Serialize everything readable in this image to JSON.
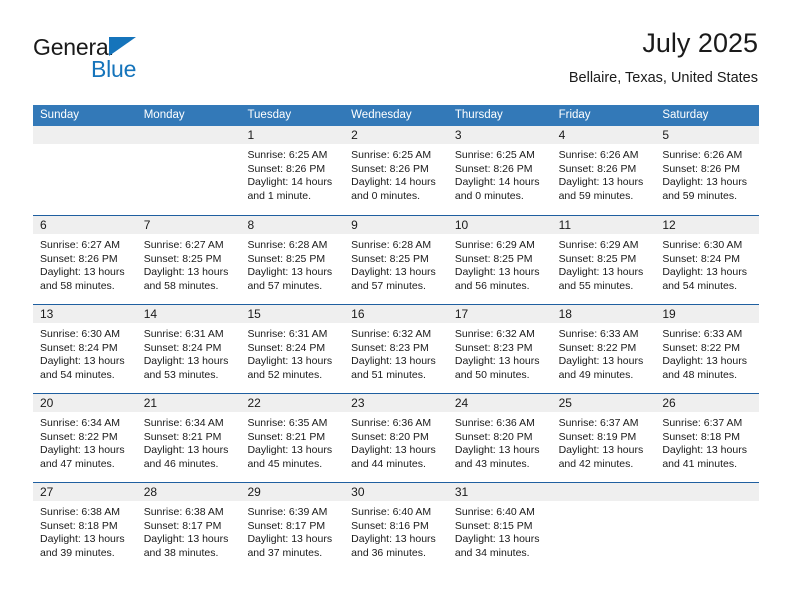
{
  "brand": {
    "name_top": "General",
    "name_bottom": "Blue",
    "logo_icon": "blue-triangle-icon",
    "colors": {
      "black": "#1a1a1a",
      "blue": "#1574bb"
    }
  },
  "header": {
    "title": "July 2025",
    "subtitle": "Bellaire, Texas, United States"
  },
  "theme": {
    "header_blue": "#3379b8",
    "row_divider_blue": "#1f5fa0",
    "day_band_gray": "#efefef"
  },
  "calendar": {
    "weekdays": [
      "Sunday",
      "Monday",
      "Tuesday",
      "Wednesday",
      "Thursday",
      "Friday",
      "Saturday"
    ],
    "weeks": [
      [
        {
          "day": "",
          "lines": []
        },
        {
          "day": "",
          "lines": []
        },
        {
          "day": "1",
          "lines": [
            "Sunrise: 6:25 AM",
            "Sunset: 8:26 PM",
            "Daylight: 14 hours",
            "and 1 minute."
          ]
        },
        {
          "day": "2",
          "lines": [
            "Sunrise: 6:25 AM",
            "Sunset: 8:26 PM",
            "Daylight: 14 hours",
            "and 0 minutes."
          ]
        },
        {
          "day": "3",
          "lines": [
            "Sunrise: 6:25 AM",
            "Sunset: 8:26 PM",
            "Daylight: 14 hours",
            "and 0 minutes."
          ]
        },
        {
          "day": "4",
          "lines": [
            "Sunrise: 6:26 AM",
            "Sunset: 8:26 PM",
            "Daylight: 13 hours",
            "and 59 minutes."
          ]
        },
        {
          "day": "5",
          "lines": [
            "Sunrise: 6:26 AM",
            "Sunset: 8:26 PM",
            "Daylight: 13 hours",
            "and 59 minutes."
          ]
        }
      ],
      [
        {
          "day": "6",
          "lines": [
            "Sunrise: 6:27 AM",
            "Sunset: 8:26 PM",
            "Daylight: 13 hours",
            "and 58 minutes."
          ]
        },
        {
          "day": "7",
          "lines": [
            "Sunrise: 6:27 AM",
            "Sunset: 8:25 PM",
            "Daylight: 13 hours",
            "and 58 minutes."
          ]
        },
        {
          "day": "8",
          "lines": [
            "Sunrise: 6:28 AM",
            "Sunset: 8:25 PM",
            "Daylight: 13 hours",
            "and 57 minutes."
          ]
        },
        {
          "day": "9",
          "lines": [
            "Sunrise: 6:28 AM",
            "Sunset: 8:25 PM",
            "Daylight: 13 hours",
            "and 57 minutes."
          ]
        },
        {
          "day": "10",
          "lines": [
            "Sunrise: 6:29 AM",
            "Sunset: 8:25 PM",
            "Daylight: 13 hours",
            "and 56 minutes."
          ]
        },
        {
          "day": "11",
          "lines": [
            "Sunrise: 6:29 AM",
            "Sunset: 8:25 PM",
            "Daylight: 13 hours",
            "and 55 minutes."
          ]
        },
        {
          "day": "12",
          "lines": [
            "Sunrise: 6:30 AM",
            "Sunset: 8:24 PM",
            "Daylight: 13 hours",
            "and 54 minutes."
          ]
        }
      ],
      [
        {
          "day": "13",
          "lines": [
            "Sunrise: 6:30 AM",
            "Sunset: 8:24 PM",
            "Daylight: 13 hours",
            "and 54 minutes."
          ]
        },
        {
          "day": "14",
          "lines": [
            "Sunrise: 6:31 AM",
            "Sunset: 8:24 PM",
            "Daylight: 13 hours",
            "and 53 minutes."
          ]
        },
        {
          "day": "15",
          "lines": [
            "Sunrise: 6:31 AM",
            "Sunset: 8:24 PM",
            "Daylight: 13 hours",
            "and 52 minutes."
          ]
        },
        {
          "day": "16",
          "lines": [
            "Sunrise: 6:32 AM",
            "Sunset: 8:23 PM",
            "Daylight: 13 hours",
            "and 51 minutes."
          ]
        },
        {
          "day": "17",
          "lines": [
            "Sunrise: 6:32 AM",
            "Sunset: 8:23 PM",
            "Daylight: 13 hours",
            "and 50 minutes."
          ]
        },
        {
          "day": "18",
          "lines": [
            "Sunrise: 6:33 AM",
            "Sunset: 8:22 PM",
            "Daylight: 13 hours",
            "and 49 minutes."
          ]
        },
        {
          "day": "19",
          "lines": [
            "Sunrise: 6:33 AM",
            "Sunset: 8:22 PM",
            "Daylight: 13 hours",
            "and 48 minutes."
          ]
        }
      ],
      [
        {
          "day": "20",
          "lines": [
            "Sunrise: 6:34 AM",
            "Sunset: 8:22 PM",
            "Daylight: 13 hours",
            "and 47 minutes."
          ]
        },
        {
          "day": "21",
          "lines": [
            "Sunrise: 6:34 AM",
            "Sunset: 8:21 PM",
            "Daylight: 13 hours",
            "and 46 minutes."
          ]
        },
        {
          "day": "22",
          "lines": [
            "Sunrise: 6:35 AM",
            "Sunset: 8:21 PM",
            "Daylight: 13 hours",
            "and 45 minutes."
          ]
        },
        {
          "day": "23",
          "lines": [
            "Sunrise: 6:36 AM",
            "Sunset: 8:20 PM",
            "Daylight: 13 hours",
            "and 44 minutes."
          ]
        },
        {
          "day": "24",
          "lines": [
            "Sunrise: 6:36 AM",
            "Sunset: 8:20 PM",
            "Daylight: 13 hours",
            "and 43 minutes."
          ]
        },
        {
          "day": "25",
          "lines": [
            "Sunrise: 6:37 AM",
            "Sunset: 8:19 PM",
            "Daylight: 13 hours",
            "and 42 minutes."
          ]
        },
        {
          "day": "26",
          "lines": [
            "Sunrise: 6:37 AM",
            "Sunset: 8:18 PM",
            "Daylight: 13 hours",
            "and 41 minutes."
          ]
        }
      ],
      [
        {
          "day": "27",
          "lines": [
            "Sunrise: 6:38 AM",
            "Sunset: 8:18 PM",
            "Daylight: 13 hours",
            "and 39 minutes."
          ]
        },
        {
          "day": "28",
          "lines": [
            "Sunrise: 6:38 AM",
            "Sunset: 8:17 PM",
            "Daylight: 13 hours",
            "and 38 minutes."
          ]
        },
        {
          "day": "29",
          "lines": [
            "Sunrise: 6:39 AM",
            "Sunset: 8:17 PM",
            "Daylight: 13 hours",
            "and 37 minutes."
          ]
        },
        {
          "day": "30",
          "lines": [
            "Sunrise: 6:40 AM",
            "Sunset: 8:16 PM",
            "Daylight: 13 hours",
            "and 36 minutes."
          ]
        },
        {
          "day": "31",
          "lines": [
            "Sunrise: 6:40 AM",
            "Sunset: 8:15 PM",
            "Daylight: 13 hours",
            "and 34 minutes."
          ]
        },
        {
          "day": "",
          "lines": []
        },
        {
          "day": "",
          "lines": []
        }
      ]
    ]
  }
}
